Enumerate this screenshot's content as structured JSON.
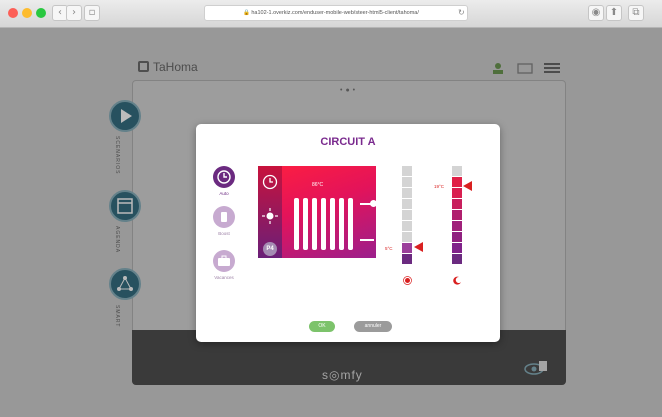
{
  "browser": {
    "url": "🔒 ha102-1.overkiz.com/enduser-mobile-web/steer-html5-client/tahoma/",
    "reload_glyph": "↻",
    "nav_back": "‹",
    "nav_forward": "›",
    "sidebar_toggle": "▫",
    "right_icons": [
      "◉",
      "⬆",
      "⧉"
    ],
    "traffic_lights": [
      "#fc5f57",
      "#fdbc2e",
      "#29c840"
    ]
  },
  "app": {
    "logo_text": "TaHoma",
    "pager_dots": "•●•",
    "footer_brand": "s◎mfy",
    "side_nav": [
      "SCENARIOS",
      "AGENDA",
      "SMART"
    ]
  },
  "modal": {
    "title": "CIRCUIT A",
    "modes": [
      {
        "label": "Auto",
        "icon": "clock-icon",
        "active": true
      },
      {
        "label": "Boost",
        "icon": "boost-icon",
        "active": false
      },
      {
        "label": "Vacances",
        "icon": "suitcase-icon",
        "active": false
      }
    ],
    "heater": {
      "temperature": "86°C",
      "program": "P4",
      "program_icon": "sun-icon",
      "clock_icon": "clock-icon"
    },
    "thermostat_left": {
      "label": "5°C",
      "icon": "sun-icon"
    },
    "thermostat_right": {
      "label": "19°C",
      "icon": "moon-icon"
    },
    "ok_label": "OK",
    "cancel_label": "annuler"
  },
  "colors": {
    "accent": "#7a2a8e",
    "heater_gradient_start": "#ff1f3f",
    "heater_gradient_end": "#9b1f8c",
    "ok": "#7cc36b",
    "cancel": "#9b9b9b",
    "pointer": "#d92020"
  }
}
